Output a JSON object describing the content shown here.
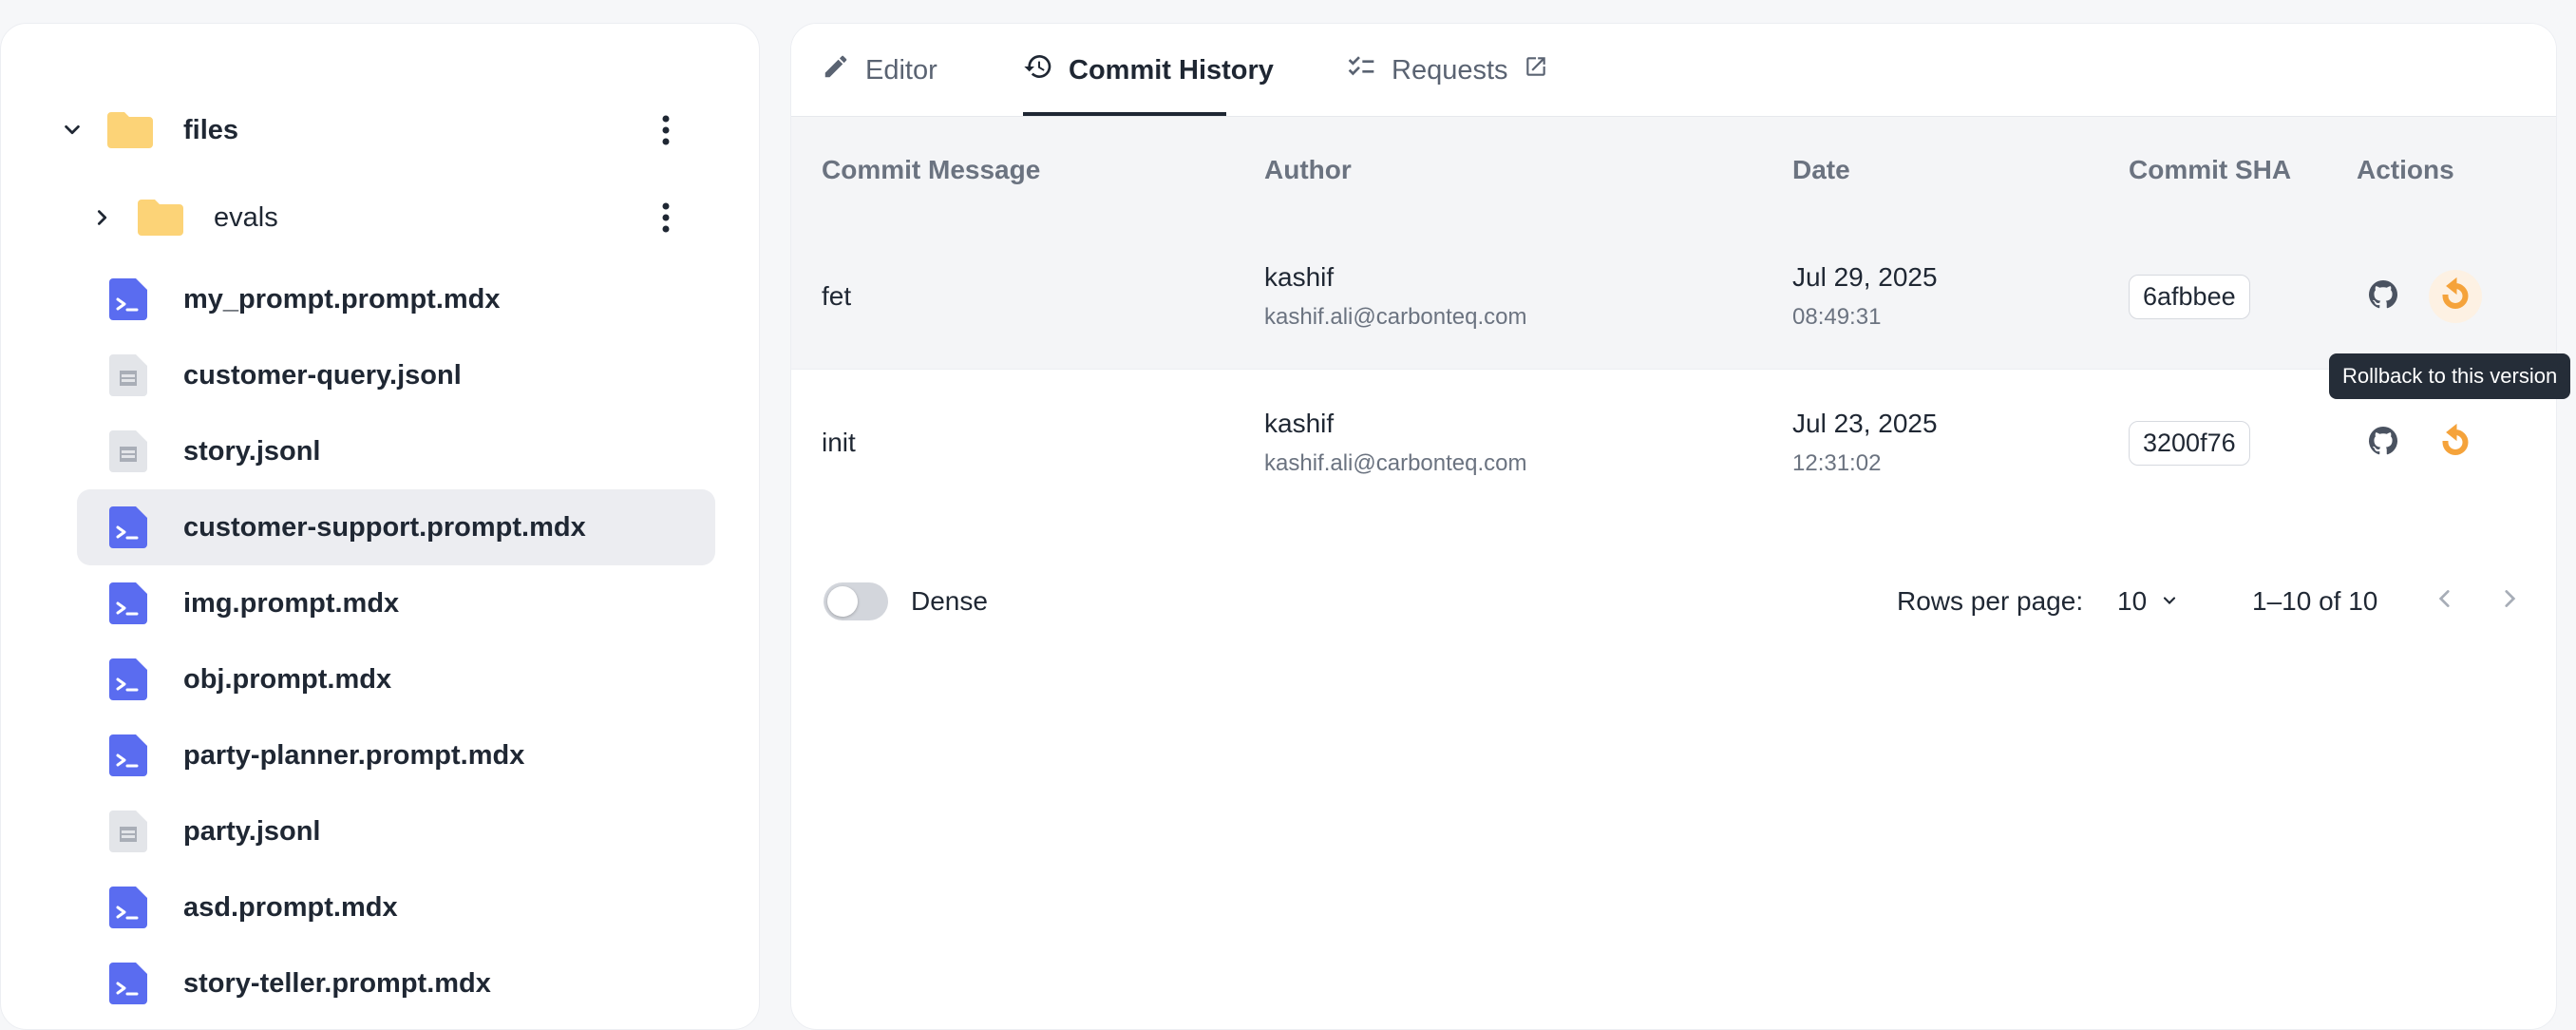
{
  "tree": {
    "root": {
      "label": "files"
    },
    "folders": [
      {
        "label": "evals"
      }
    ],
    "files": [
      {
        "label": "my_prompt.prompt.mdx",
        "kind": "prompt"
      },
      {
        "label": "customer-query.jsonl",
        "kind": "jsonl"
      },
      {
        "label": "story.jsonl",
        "kind": "jsonl"
      },
      {
        "label": "customer-support.prompt.mdx",
        "kind": "prompt"
      },
      {
        "label": "img.prompt.mdx",
        "kind": "prompt"
      },
      {
        "label": "obj.prompt.mdx",
        "kind": "prompt"
      },
      {
        "label": "party-planner.prompt.mdx",
        "kind": "prompt"
      },
      {
        "label": "party.jsonl",
        "kind": "jsonl"
      },
      {
        "label": "asd.prompt.mdx",
        "kind": "prompt"
      },
      {
        "label": "story-teller.prompt.mdx",
        "kind": "prompt"
      }
    ],
    "selected": "customer-support.prompt.mdx"
  },
  "tabs": {
    "editor": "Editor",
    "history": "Commit History",
    "requests": "Requests",
    "active": "Commit History"
  },
  "table": {
    "headers": {
      "message": "Commit Message",
      "author": "Author",
      "date": "Date",
      "sha": "Commit SHA",
      "actions": "Actions"
    },
    "rows": [
      {
        "message": "fet",
        "author": "kashif",
        "email": "kashif.ali@carbonteq.com",
        "date": "Jul 29, 2025",
        "time": "08:49:31",
        "sha": "6afbbee"
      },
      {
        "message": "init",
        "author": "kashif",
        "email": "kashif.ali@carbonteq.com",
        "date": "Jul 23, 2025",
        "time": "12:31:02",
        "sha": "3200f76"
      }
    ]
  },
  "tooltip": "Rollback to this version",
  "footer": {
    "dense_label": "Dense",
    "rows_per_page_label": "Rows per page:",
    "rows_per_page_value": "10",
    "range": "1–10 of 10"
  },
  "colors": {
    "prompt_icon": "#5a6cf0",
    "folder": "#fcd377",
    "rollback": "#f5a33b",
    "jsonl_icon": "#e3e5e9"
  },
  "icons": {
    "editor": "pencil-icon",
    "history": "history-icon",
    "requests": "checklist-icon",
    "external": "external-link-icon",
    "github": "github-icon",
    "rollback": "rollback-icon"
  }
}
